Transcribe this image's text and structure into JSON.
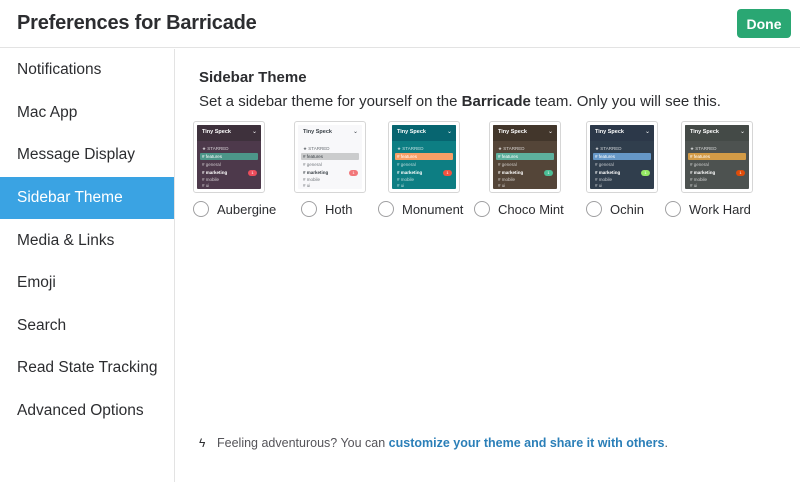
{
  "header": {
    "title": "Preferences for Barricade",
    "done_label": "Done"
  },
  "sidebar": {
    "items": [
      {
        "label": "Notifications"
      },
      {
        "label": "Mac App"
      },
      {
        "label": "Message Display"
      },
      {
        "label": "Sidebar Theme"
      },
      {
        "label": "Media & Links"
      },
      {
        "label": "Emoji"
      },
      {
        "label": "Search"
      },
      {
        "label": "Read State Tracking"
      },
      {
        "label": "Advanced Options"
      }
    ],
    "active_index": 3
  },
  "section": {
    "title": "Sidebar Theme",
    "desc_before": "Set a sidebar theme for yourself on the ",
    "desc_team": "Barricade",
    "desc_after": " team. Only you will see this."
  },
  "preview": {
    "team": "Tiny Speck",
    "starred": "★ STARRED",
    "features": "# features",
    "general": "# general",
    "marketing": "# marketing",
    "mobile": "# mobile",
    "ui": "# ui",
    "badge": "1"
  },
  "themes": [
    {
      "name": "Aubergine",
      "colors": {
        "bg": "#4d394b",
        "top": "#3e313c",
        "active": "#4c9689",
        "text": "#ffffff",
        "badge": "#eb4d5c"
      }
    },
    {
      "name": "Hoth",
      "colors": {
        "bg": "#f8f8fa",
        "top": "#f8f8fa",
        "active": "#cbcccd",
        "text": "#383f45",
        "badge": "#f2777a"
      }
    },
    {
      "name": "Monument",
      "colors": {
        "bg": "#0d7e83",
        "top": "#076570",
        "active": "#f79f66",
        "text": "#ffffff",
        "badge": "#f15340"
      }
    },
    {
      "name": "Choco Mint",
      "colors": {
        "bg": "#544538",
        "top": "#42362b",
        "active": "#5db09d",
        "text": "#ffffff",
        "badge": "#4bbe96"
      }
    },
    {
      "name": "Ochin",
      "colors": {
        "bg": "#303e4d",
        "top": "#2c3849",
        "active": "#6698c8",
        "text": "#ffffff",
        "badge": "#94e864"
      }
    },
    {
      "name": "Work Hard",
      "colors": {
        "bg": "#4d5250",
        "top": "#444a47",
        "active": "#d39b46",
        "text": "#ffffff",
        "badge": "#de4c0a"
      }
    }
  ],
  "footer": {
    "prefix": "Feeling adventurous? You can ",
    "link": "customize your theme and share it with others",
    "suffix": "."
  }
}
